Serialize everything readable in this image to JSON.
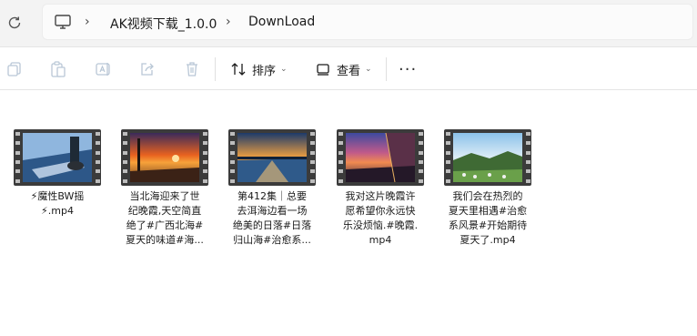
{
  "address": {
    "crumbs": [
      "AK视频下载_1.0.0",
      "DownLoad"
    ],
    "separator": "›"
  },
  "toolbar": {
    "sort_label": "排序",
    "view_label": "查看",
    "more_label": "···"
  },
  "files": [
    {
      "name": "⚡魔性BW摇⚡.mp4",
      "lines": [
        "⚡魔性BW摇",
        "⚡.mp4"
      ]
    },
    {
      "name": "当北海迎来了世纪晚霞,天空简直绝了#广西北海#夏天的味道#海...",
      "lines": [
        "当北海迎来了世",
        "纪晚霞,天空简直",
        "绝了#广西北海#",
        "夏天的味道#海..."
      ]
    },
    {
      "name": "第412集｜总要去洱海边看一场绝美的日落#日落归山海#治愈系...",
      "lines": [
        "第412集｜总要",
        "去洱海边看一场",
        "绝美的日落#日落",
        "归山海#治愈系..."
      ]
    },
    {
      "name": "我对这片晚霞许愿希望你永远快乐没烦恼.#晚霞.mp4",
      "lines": [
        "我对这片晚霞许",
        "愿希望你永远快",
        "乐没烦恼.#晚霞.",
        "mp4"
      ]
    },
    {
      "name": "我们会在热烈的夏天里相遇#治愈系风景#开始期待夏天了.mp4",
      "lines": [
        "我们会在热烈的",
        "夏天里相遇#治愈",
        "系风景#开始期待",
        "夏天了.mp4"
      ]
    }
  ],
  "colors": {
    "accent": "#0067c0",
    "addressbar_bg": "#f3f3f3",
    "film": "#3b3b3b"
  }
}
